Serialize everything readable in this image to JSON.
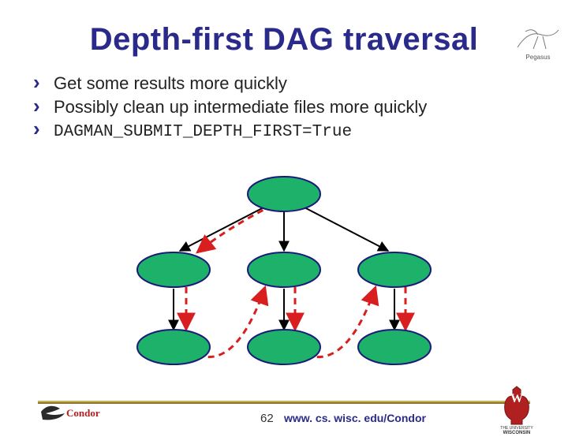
{
  "title": "Depth-first DAG traversal",
  "bullets": {
    "b1": "Get some results more quickly",
    "b2": "Possibly clean up intermediate files more quickly",
    "b3": "DAGMAN_SUBMIT_DEPTH_FIRST=True"
  },
  "footer": {
    "slide_number": "62",
    "url": "www. cs. wisc. edu/Condor",
    "condor_label": "Condor",
    "wisc_label_top": "THE UNIVERSITY",
    "wisc_label_bot": "WISCONSIN",
    "pegasus_label": "Pegasus"
  },
  "chart_data": {
    "type": "diagram",
    "description": "Directed acyclic graph illustrating depth-first traversal order",
    "nodes": [
      {
        "id": "A",
        "row": 0,
        "col": 1
      },
      {
        "id": "B1",
        "row": 1,
        "col": 0
      },
      {
        "id": "B2",
        "row": 1,
        "col": 1
      },
      {
        "id": "B3",
        "row": 1,
        "col": 2
      },
      {
        "id": "C1",
        "row": 2,
        "col": 0
      },
      {
        "id": "C2",
        "row": 2,
        "col": 1
      },
      {
        "id": "C3",
        "row": 2,
        "col": 2
      }
    ],
    "edges_solid": [
      [
        "A",
        "B1"
      ],
      [
        "A",
        "B2"
      ],
      [
        "A",
        "B3"
      ],
      [
        "B1",
        "C1"
      ],
      [
        "B2",
        "C2"
      ],
      [
        "B3",
        "C3"
      ]
    ],
    "traversal_dashed_path": [
      "A",
      "B1",
      "C1",
      "B2",
      "C2",
      "B3",
      "C3"
    ],
    "colors": {
      "node_fill": "#1db16a",
      "node_stroke": "#1a1a7a",
      "edge": "#000000",
      "dashed": "#d81e1e"
    }
  }
}
